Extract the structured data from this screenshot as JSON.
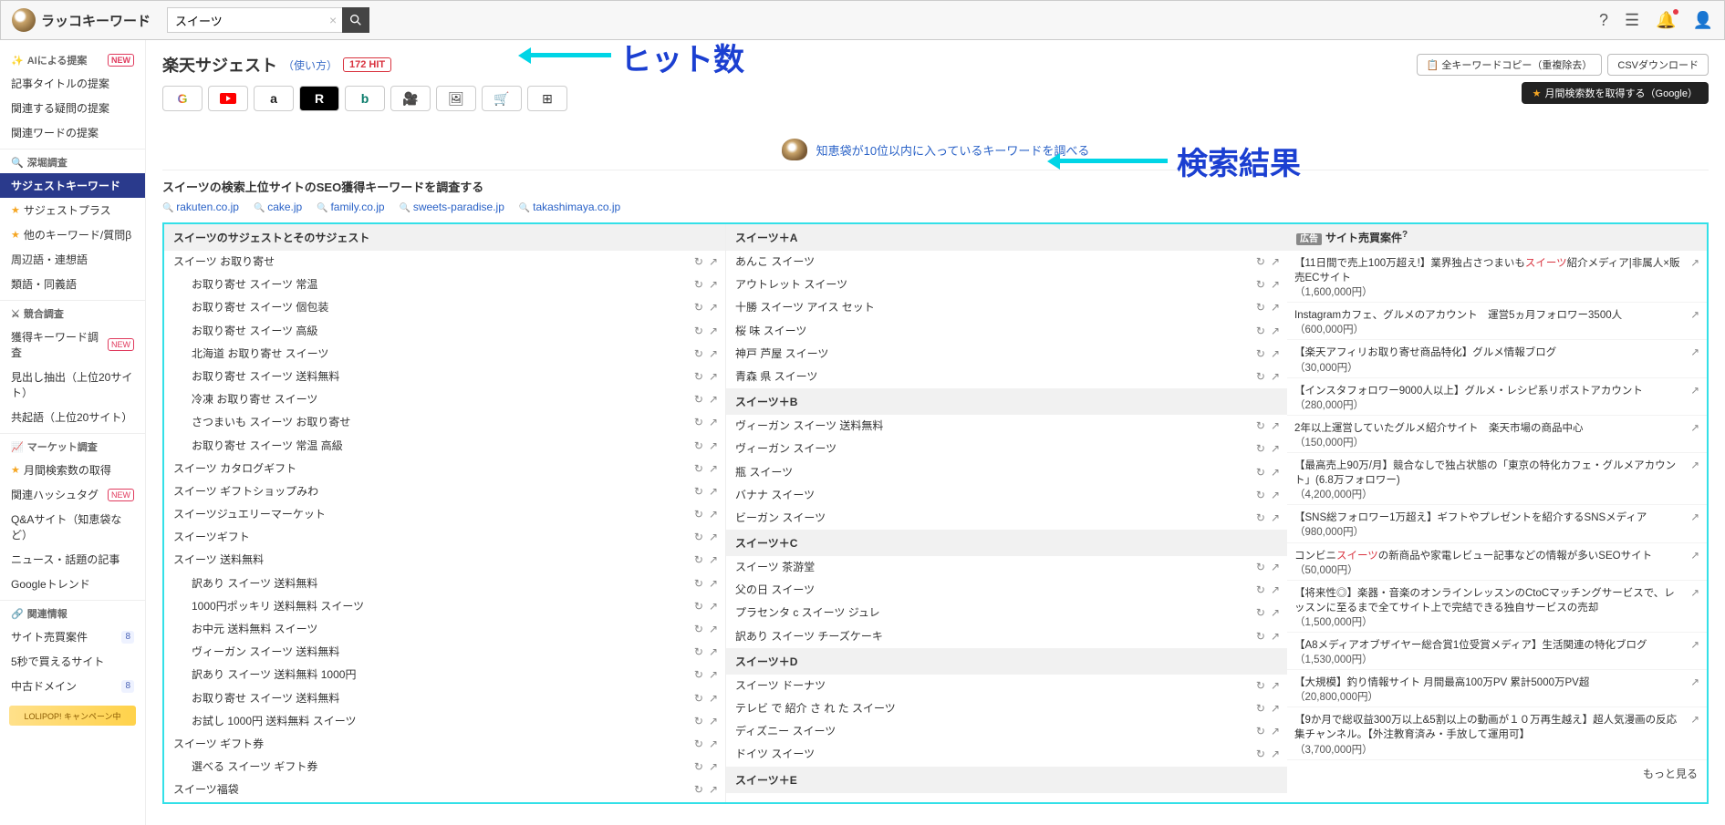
{
  "header": {
    "logo_text": "ラッコキーワード",
    "search_value": "スイーツ"
  },
  "sidebar": {
    "ai": {
      "head": "AIによる提案",
      "badge": "NEW",
      "items": [
        "記事タイトルの提案",
        "関連する疑問の提案",
        "関連ワードの提案"
      ]
    },
    "deep": {
      "head": "深堀調査",
      "items": [
        {
          "label": "サジェストキーワード",
          "active": true
        },
        {
          "label": "サジェストプラス",
          "star": true
        },
        {
          "label": "他のキーワード/質問β",
          "star": true
        },
        {
          "label": "周辺語・連想語"
        },
        {
          "label": "類語・同義語"
        }
      ]
    },
    "compete": {
      "head": "競合調査",
      "items": [
        {
          "label": "獲得キーワード調査",
          "badge": "NEW"
        },
        {
          "label": "見出し抽出（上位20サイト）"
        },
        {
          "label": "共起語（上位20サイト）"
        }
      ]
    },
    "market": {
      "head": "マーケット調査",
      "items": [
        {
          "label": "月間検索数の取得",
          "star": true
        },
        {
          "label": "関連ハッシュタグ",
          "badge": "NEW"
        },
        {
          "label": "Q&Aサイト（知恵袋など）"
        },
        {
          "label": "ニュース・話題の記事"
        },
        {
          "label": "Googleトレンド"
        }
      ]
    },
    "related": {
      "head": "関連情報",
      "items": [
        {
          "label": "サイト売買案件",
          "count": "8"
        },
        {
          "label": "5秒で買えるサイト"
        },
        {
          "label": "中古ドメイン",
          "count": "8"
        }
      ]
    },
    "promo": "LOLIPOP! キャンペーン中"
  },
  "title": {
    "text": "楽天サジェスト",
    "usage": "（使い方）",
    "hit": "172 HIT",
    "copy_btn": "全キーワードコピー（重複除去）",
    "csv_btn": "CSVダウンロード",
    "volume_btn": "月間検索数を取得する（Google）"
  },
  "annotations": {
    "hit": "ヒット数",
    "results": "検索結果"
  },
  "engines": [
    "google",
    "youtube",
    "amazon",
    "rakuten",
    "bing",
    "video",
    "image",
    "shopping",
    "windows"
  ],
  "banner": "知恵袋が10位以内に入っているキーワードを調べる",
  "seo": {
    "title": "スイーツの検索上位サイトのSEO獲得キーワードを調査する",
    "sites": [
      "rakuten.co.jp",
      "cake.jp",
      "family.co.jp",
      "sweets-paradise.jp",
      "takashimaya.co.jp"
    ]
  },
  "col1": {
    "head": "スイーツのサジェストとそのサジェスト",
    "rows": [
      {
        "t": "スイーツ お取り寄せ"
      },
      {
        "t": "お取り寄せ スイーツ 常温",
        "c": true
      },
      {
        "t": "お取り寄せ スイーツ 個包装",
        "c": true
      },
      {
        "t": "お取り寄せ スイーツ 高級",
        "c": true
      },
      {
        "t": "北海道 お取り寄せ スイーツ",
        "c": true
      },
      {
        "t": "お取り寄せ スイーツ 送料無料",
        "c": true
      },
      {
        "t": "冷凍 お取り寄せ スイーツ",
        "c": true
      },
      {
        "t": "さつまいも スイーツ お取り寄せ",
        "c": true
      },
      {
        "t": "お取り寄せ スイーツ 常温 高級",
        "c": true
      },
      {
        "t": "スイーツ カタログギフト"
      },
      {
        "t": "スイーツ ギフトショップみわ"
      },
      {
        "t": "スイーツジュエリーマーケット"
      },
      {
        "t": "スイーツギフト"
      },
      {
        "t": "スイーツ 送料無料"
      },
      {
        "t": "訳あり スイーツ 送料無料",
        "c": true
      },
      {
        "t": "1000円ポッキリ 送料無料 スイーツ",
        "c": true
      },
      {
        "t": "お中元 送料無料 スイーツ",
        "c": true
      },
      {
        "t": "ヴィーガン スイーツ 送料無料",
        "c": true
      },
      {
        "t": "訳あり スイーツ 送料無料 1000円",
        "c": true
      },
      {
        "t": "お取り寄せ スイーツ 送料無料",
        "c": true
      },
      {
        "t": "お試し 1000円 送料無料 スイーツ",
        "c": true
      },
      {
        "t": "スイーツ ギフト券"
      },
      {
        "t": "選べる スイーツ ギフト券",
        "c": true
      },
      {
        "t": "スイーツ福袋"
      }
    ]
  },
  "col2": {
    "groups": [
      {
        "head": "スイーツ＋A",
        "rows": [
          "あんこ スイーツ",
          "アウトレット スイーツ",
          "十勝 スイーツ アイス セット",
          "桜 味 スイーツ",
          "神戸 芦屋 スイーツ",
          "青森 県 スイーツ"
        ]
      },
      {
        "head": "スイーツ＋B",
        "rows": [
          "ヴィーガン スイーツ 送料無料",
          "ヴィーガン スイーツ",
          "瓶 スイーツ",
          "バナナ スイーツ",
          "ビーガン スイーツ"
        ]
      },
      {
        "head": "スイーツ＋C",
        "rows": [
          "スイーツ 茶游堂",
          "父の日 スイーツ",
          "プラセンタ c スイーツ ジュレ",
          "訳あり スイーツ チーズケーキ"
        ]
      },
      {
        "head": "スイーツ＋D",
        "rows": [
          "スイーツ ドーナツ",
          "テレビ で 紹介 さ れ た スイーツ",
          "ディズニー スイーツ",
          "ドイツ スイーツ"
        ]
      },
      {
        "head": "スイーツ＋E",
        "rows": []
      }
    ]
  },
  "ads": {
    "head": "サイト売買案件",
    "ad_label": "広告",
    "more": "もっと見る",
    "items": [
      {
        "text": "【11日間で売上100万超え!】業界独占さつまいも",
        "hl": "スイーツ",
        "tail": "紹介メディア|非属人×販売ECサイト",
        "price": "（1,600,000円）"
      },
      {
        "text": "Instagramカフェ、グルメのアカウント　運営5ヵ月フォロワー3500人",
        "price": "（600,000円）"
      },
      {
        "text": "【楽天アフィリお取り寄せ商品特化】グルメ情報ブログ",
        "price": "（30,000円）"
      },
      {
        "text": "【インスタフォロワー9000人以上】グルメ・レシピ系リポストアカウント",
        "price": "（280,000円）"
      },
      {
        "text": "2年以上運営していたグルメ紹介サイト　楽天市場の商品中心",
        "price": "（150,000円）"
      },
      {
        "text": "【最高売上90万/月】競合なしで独占状態の「東京の特化カフェ・グルメアカウント」(6.8万フォロワー)",
        "price": "（4,200,000円）"
      },
      {
        "text": "【SNS総フォロワー1万超え】ギフトやプレゼントを紹介するSNSメディア",
        "price": "（980,000円）"
      },
      {
        "text": "コンビニ",
        "hl": "スイーツ",
        "tail": "の新商品や家電レビュー記事などの情報が多いSEOサイト",
        "price": "（50,000円）"
      },
      {
        "text": "【将来性◎】楽器・音楽のオンラインレッスンのCtoCマッチングサービスで、レッスンに至るまで全てサイト上で完結できる独自サービスの売却",
        "price": "（1,500,000円）"
      },
      {
        "text": "【A8メディアオブザイヤー総合賞1位受賞メディア】生活関連の特化ブログ",
        "price": "（1,530,000円）"
      },
      {
        "text": "【大規模】釣り情報サイト 月間最高100万PV 累計5000万PV超",
        "price": "（20,800,000円）"
      },
      {
        "text": "【9か月で総収益300万以上&5割以上の動画が１０万再生越え】超人気漫画の反応集チャンネル。【外注教育済み・手放して運用可】",
        "price": "（3,700,000円）"
      }
    ]
  }
}
